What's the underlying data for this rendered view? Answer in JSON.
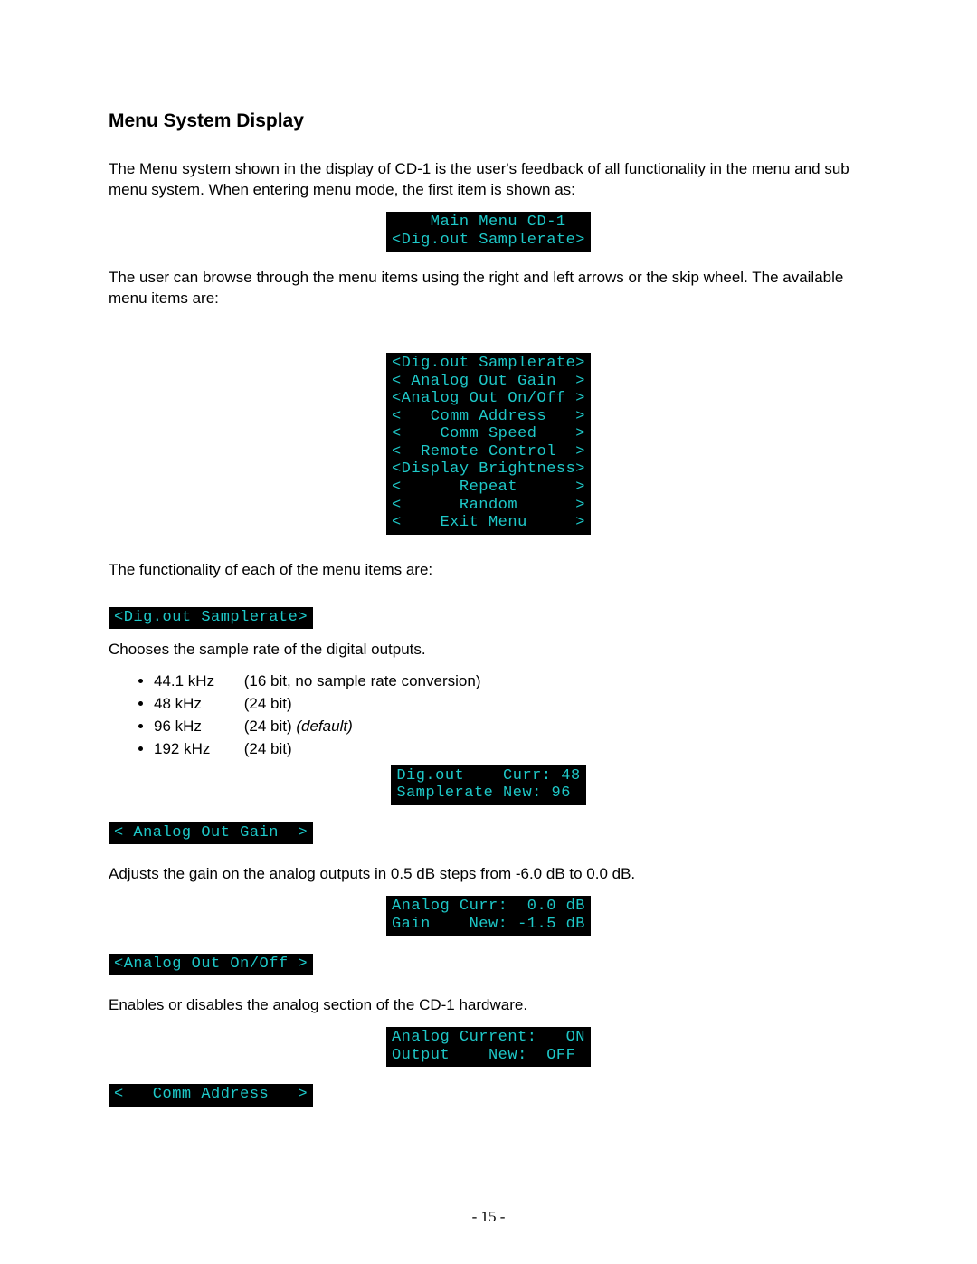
{
  "heading": "Menu System Display",
  "para1": "The Menu system shown in the display of CD-1 is the user's feedback of all functionality in the menu and sub menu system. When entering menu mode, the first item is shown as:",
  "lcd_main": "  Main Menu CD-1\n<Dig.out Samplerate>",
  "para2": "The user can browse through the menu items using the right and left arrows or the skip wheel. The available menu items are:",
  "lcd_menu_list": "<Dig.out Samplerate>\n< Analog Out Gain  >\n<Analog Out On/Off >\n<   Comm Address   >\n<    Comm Speed    >\n<  Remote Control  >\n<Display Brightness>\n<      Repeat      >\n<      Random      >\n<    Exit Menu     >",
  "para3": "The functionality of each of the menu items are:",
  "lcd_dig_out_hdr": "<Dig.out Samplerate>",
  "para4": "Chooses the sample rate of the digital outputs.",
  "samplerates": [
    {
      "col1": "44.1 kHz",
      "col2": "(16 bit, no sample rate conversion)",
      "default": ""
    },
    {
      "col1": "48 kHz",
      "col2": "(24 bit)",
      "default": ""
    },
    {
      "col1": "96 kHz",
      "col2": "(24 bit)",
      "default": "(default)"
    },
    {
      "col1": "192 kHz",
      "col2": "(24 bit)",
      "default": ""
    }
  ],
  "lcd_dig_out_vals": "Dig.out    Curr: 48\nSamplerate New: 96 ",
  "lcd_analog_gain_hdr": "< Analog Out Gain  >",
  "para5": "Adjusts the gain on the analog outputs in 0.5 dB steps from -6.0 dB to 0.0 dB.",
  "lcd_analog_gain_vals": "Analog Curr:  0.0 dB\nGain    New: -1.5 dB",
  "lcd_analog_onoff_hdr": "<Analog Out On/Off >",
  "para6": "Enables or disables the analog section of the CD-1 hardware.",
  "lcd_analog_onoff_vals": "Analog Current:   ON\nOutput    New:  OFF ",
  "lcd_comm_addr_hdr": "<   Comm Address   >",
  "page_number": "- 15 -"
}
